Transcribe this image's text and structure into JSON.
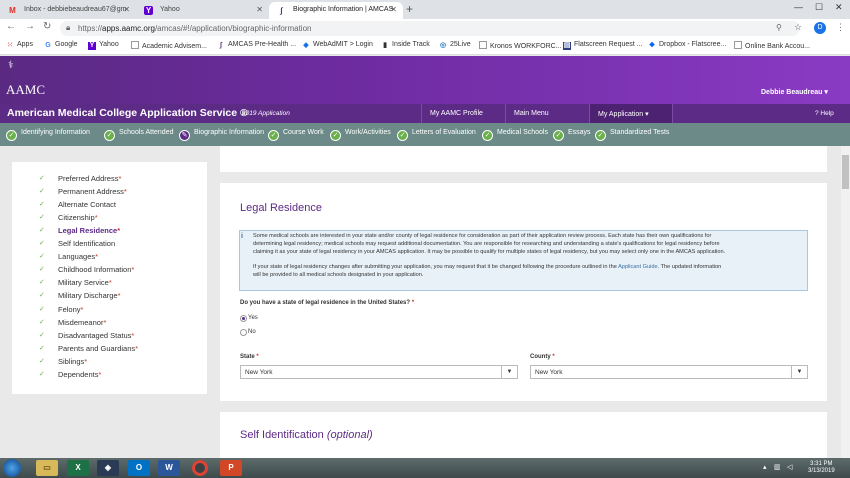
{
  "browser": {
    "tabs": [
      {
        "label": "Inbox - debbiebeaudreau67@gm",
        "icon": "gmail-icon"
      },
      {
        "label": "Yahoo",
        "icon": "yahoo-icon"
      },
      {
        "label": "Biographic Information | AMCAS",
        "icon": "amcas-icon"
      }
    ],
    "url_prefix": "https://",
    "url_host": "apps.aamc.org",
    "url_path": "/amcas/#!/application/biographic-information",
    "profile_initial": "D",
    "bookmarks": [
      "Apps",
      "Google",
      "Yahoo",
      "Academic Advisem...",
      "AMCAS Pre-Health ...",
      "WebAdMIT > Login",
      "Inside Track",
      "25Live",
      "Kronos WORKFORC...",
      "Flatscreen Request ...",
      "Dropbox - Flatscree...",
      "Online Bank Accou..."
    ]
  },
  "header": {
    "logo": "AAMC",
    "user": "Debbie Beaudreau ▾",
    "app_title": "American Medical College Application Service ®",
    "app_year": "2019 Application",
    "menu": [
      "My AAMC Profile",
      "Main Menu",
      "My Application ▾"
    ],
    "help": "? Help"
  },
  "steps": [
    "Identifying Information",
    "Schools Attended",
    "Biographic Information",
    "Course Work",
    "Work/Activities",
    "Letters of Evaluation",
    "Medical Schools",
    "Essays",
    "Standardized Tests"
  ],
  "sidebar": {
    "items": [
      {
        "label": "Preferred Address",
        "req": "*"
      },
      {
        "label": "Permanent Address",
        "req": "*"
      },
      {
        "label": "Alternate Contact",
        "req": ""
      },
      {
        "label": "Citizenship",
        "req": "*"
      },
      {
        "label": "Legal Residence",
        "req": "*"
      },
      {
        "label": "Self Identification",
        "req": ""
      },
      {
        "label": "Languages",
        "req": "*"
      },
      {
        "label": "Childhood Information",
        "req": "*"
      },
      {
        "label": "Military Service",
        "req": "*"
      },
      {
        "label": "Military Discharge",
        "req": "*"
      },
      {
        "label": "Felony",
        "req": "*"
      },
      {
        "label": "Misdemeanor",
        "req": "*"
      },
      {
        "label": "Disadvantaged Status",
        "req": "*"
      },
      {
        "label": "Parents and Guardians",
        "req": "*"
      },
      {
        "label": "Siblings",
        "req": "*"
      },
      {
        "label": "Dependents",
        "req": "*"
      }
    ]
  },
  "legal": {
    "title": "Legal Residence",
    "info_lines": [
      "Some medical schools are interested in your state and/or county of legal residence for consideration as part of their application review process. Each state has their own qualifications for",
      "determining legal residency; medical schools may request additional documentation. You are responsible for researching and understanding a state's qualifications for legal residency before",
      "claiming it as your state of legal residency in your AMCAS application. It may be possible to qualify for multiple states of legal residency, but you may select only one in the AMCAS application."
    ],
    "info2_before": "If your state of legal residency changes after submitting your application, you may request that it be changed following the procedure outlined in the ",
    "info2_link": "Applicant Guide",
    "info2_after": ". The updated information",
    "info2_line2": "will be provided to all medical schools designated in your application.",
    "question": "Do you have a state of legal residence in the United States?",
    "yes": "Yes",
    "no": "No",
    "state_label": "State",
    "state_value": "New York",
    "county_label": "County",
    "county_value": "New York"
  },
  "self_id": {
    "title": "Self Identification",
    "optional": "(optional)"
  },
  "taskbar": {
    "time": "3:31 PM",
    "date": "3/13/2019"
  }
}
